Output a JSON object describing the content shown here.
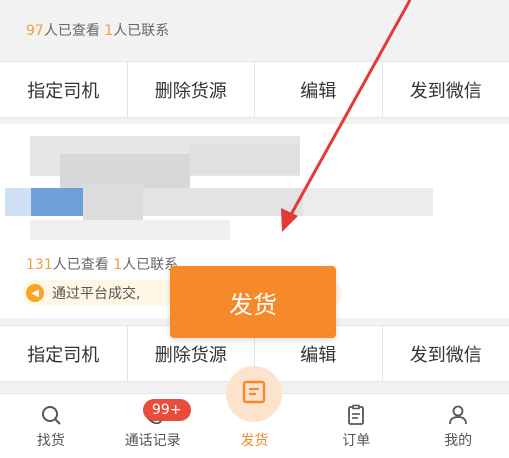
{
  "card1": {
    "views_count": "97",
    "views_label": "人已查看",
    "contacts_count": "1",
    "contacts_label": "人已联系"
  },
  "card2": {
    "views_count": "131",
    "views_label": "人已查看",
    "contacts_count": "1",
    "contacts_label": "人已联系"
  },
  "actions": [
    "指定司机",
    "删除货源",
    "编辑",
    "发到微信"
  ],
  "notice": "通过平台成交,",
  "ship_button": "发货",
  "tabs": [
    "找货",
    "通话记录",
    "发货",
    "订单",
    "我的"
  ],
  "badge": "99+",
  "colors": {
    "accent": "#f6892a",
    "arrow": "#e53935",
    "badge": "#e74c3c"
  }
}
